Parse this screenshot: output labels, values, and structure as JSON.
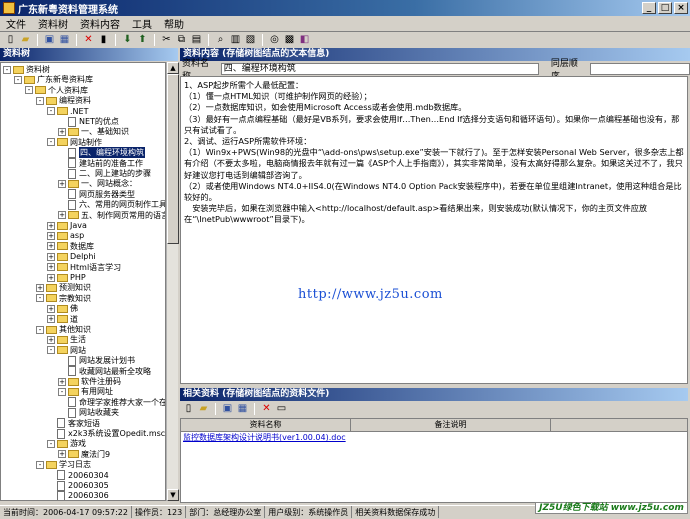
{
  "window": {
    "title": "广东新粤资料管理系统"
  },
  "menu": [
    "文件",
    "资料树",
    "资料内容",
    "工具",
    "帮助"
  ],
  "panels": {
    "tree_title": "资料树",
    "content_title": "资料内容 (存储树图结点的文本信息)",
    "related_title": "相关资料 (存储树图结点的资料文件)"
  },
  "fields": {
    "name_label": "资料名称",
    "name_value": "四、编程环境构筑",
    "order_label": "同层顺序"
  },
  "content_lines": [
    "1、ASP起步所需个人最低配置：",
    "（1）懂一点HTML知识（可维护制作网页的经验）；",
    "（2）一点数据库知识，如会使用Microsoft Access或者会使用.mdb数据库。",
    "（3）最好有一点点编程基础（最好是VB系列，要求会使用If…Then…End If选择分支语句和循环语句）。如果你一点编程基础也没有，那只有试试看了。",
    "2、调试、运行ASP所需软件环境：",
    "（1）Win9x+PWS(Win98的光盘中“\\add-ons\\pws\\setup.exe”安装一下就行了)。至于怎样安装Personal Web Server，很多杂志上都有介绍（不要太多啦，电脑商情报去年就有过一篇《ASP个人上手指南》），其实非常简单，没有太高好得那么复杂。如果这关过不了，我只好建议您打电话到编辑部咨询了。",
    "（2）或者使用Windows NT4.0+IIS4.0(在Windows NT4.0 Option Pack安装程序中)，若要在单位里组建Intranet，使用这种组合是比较好的。",
    "　安装完毕后，如果在浏览器中输入<http://localhost/default.asp>看结果出来，则安装成功(默认情况下，你的主页文件应放在“\\InetPub\\wwwroot”目录下)。"
  ],
  "watermark": "http://www.jz5u.com",
  "tree": [
    {
      "label": "资料树",
      "depth": 0,
      "type": "folder",
      "pm": "-"
    },
    {
      "label": "广东新粤资料库",
      "depth": 1,
      "type": "folder",
      "pm": "-"
    },
    {
      "label": "个人资料库",
      "depth": 2,
      "type": "folder",
      "pm": "-"
    },
    {
      "label": "编程资料",
      "depth": 3,
      "type": "folder",
      "pm": "-"
    },
    {
      "label": ".NET",
      "depth": 4,
      "type": "folder",
      "pm": "-"
    },
    {
      "label": "NET的优点",
      "depth": 5,
      "type": "doc",
      "pm": ""
    },
    {
      "label": "一、基础知识",
      "depth": 5,
      "type": "folder",
      "pm": "+"
    },
    {
      "label": "网站制作",
      "depth": 4,
      "type": "folder",
      "pm": "-"
    },
    {
      "label": "四、编程环境构筑",
      "depth": 5,
      "type": "doc",
      "pm": "",
      "selected": true
    },
    {
      "label": "建站前的准备工作",
      "depth": 5,
      "type": "doc",
      "pm": ""
    },
    {
      "label": "二、网上建站的步骤",
      "depth": 5,
      "type": "doc",
      "pm": ""
    },
    {
      "label": "一、网站概念：",
      "depth": 5,
      "type": "folder",
      "pm": "+"
    },
    {
      "label": "网页服务器类型",
      "depth": 5,
      "type": "doc",
      "pm": ""
    },
    {
      "label": "六、常用的网页制作工具",
      "depth": 5,
      "type": "doc",
      "pm": ""
    },
    {
      "label": "五、制作网页常用的语言",
      "depth": 5,
      "type": "folder",
      "pm": "+"
    },
    {
      "label": "Java",
      "depth": 4,
      "type": "folder",
      "pm": "+"
    },
    {
      "label": "asp",
      "depth": 4,
      "type": "folder",
      "pm": "+"
    },
    {
      "label": "数据库",
      "depth": 4,
      "type": "folder",
      "pm": "+"
    },
    {
      "label": "Delphi",
      "depth": 4,
      "type": "folder",
      "pm": "+"
    },
    {
      "label": "Html语言学习",
      "depth": 4,
      "type": "folder",
      "pm": "+"
    },
    {
      "label": "PHP",
      "depth": 4,
      "type": "folder",
      "pm": "+"
    },
    {
      "label": "预测知识",
      "depth": 3,
      "type": "folder",
      "pm": "+"
    },
    {
      "label": "宗教知识",
      "depth": 3,
      "type": "folder",
      "pm": "-"
    },
    {
      "label": "佛",
      "depth": 4,
      "type": "folder",
      "pm": "+"
    },
    {
      "label": "道",
      "depth": 4,
      "type": "folder",
      "pm": "+"
    },
    {
      "label": "其他知识",
      "depth": 3,
      "type": "folder",
      "pm": "-"
    },
    {
      "label": "生活",
      "depth": 4,
      "type": "folder",
      "pm": "+"
    },
    {
      "label": "网站",
      "depth": 4,
      "type": "folder",
      "pm": "-"
    },
    {
      "label": "网站发展计划书",
      "depth": 5,
      "type": "doc",
      "pm": ""
    },
    {
      "label": "收藏网站最新全攻略",
      "depth": 5,
      "type": "doc",
      "pm": ""
    },
    {
      "label": "软件注册码",
      "depth": 5,
      "type": "folder",
      "pm": "+"
    },
    {
      "label": "有用网址",
      "depth": 5,
      "type": "folder",
      "pm": "-"
    },
    {
      "label": "命理学家推荐大家一个在",
      "depth": 5,
      "type": "doc",
      "pm": ""
    },
    {
      "label": "网站收藏夹",
      "depth": 5,
      "type": "doc",
      "pm": ""
    },
    {
      "label": "客家短语",
      "depth": 4,
      "type": "doc",
      "pm": ""
    },
    {
      "label": "x2k3系统设置Opedit.msc",
      "depth": 4,
      "type": "doc",
      "pm": ""
    },
    {
      "label": "游戏",
      "depth": 4,
      "type": "folder",
      "pm": "-"
    },
    {
      "label": "魔法门9",
      "depth": 5,
      "type": "folder",
      "pm": "+"
    },
    {
      "label": "学习日志",
      "depth": 3,
      "type": "folder",
      "pm": "-"
    },
    {
      "label": "20060304",
      "depth": 4,
      "type": "doc",
      "pm": ""
    },
    {
      "label": "20060305",
      "depth": 4,
      "type": "doc",
      "pm": ""
    },
    {
      "label": "20060306",
      "depth": 4,
      "type": "doc",
      "pm": ""
    }
  ],
  "related_grid": {
    "columns": [
      "资料名称",
      "备注说明"
    ],
    "rows": [
      {
        "name": "监控数据库架构设计说明书(ver1.00.04).doc",
        "note": ""
      }
    ]
  },
  "statusbar": {
    "time": "当前时间：2006-04-17 09:57:22",
    "operator": "操作员：123",
    "dept": "部门：总经理办公室",
    "level": "用户级别：系统操作员",
    "action": "相关资料数据保存成功"
  },
  "logo_text": "JZ5U绿色下载站 www.jz5u.com"
}
